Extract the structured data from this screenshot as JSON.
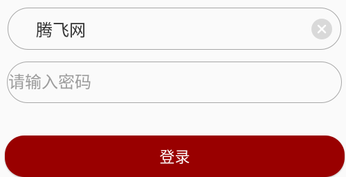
{
  "login_form": {
    "username": {
      "value": "腾飞网",
      "clear_icon": "close-icon"
    },
    "password": {
      "value": "",
      "placeholder": "请输入密码"
    },
    "submit_label": "登录"
  },
  "colors": {
    "background": "#fafafa",
    "field_border": "#a7a7a7",
    "clear_icon_bg": "#d9d9d9",
    "primary_button": "#990000",
    "primary_button_text": "#ffffff"
  }
}
